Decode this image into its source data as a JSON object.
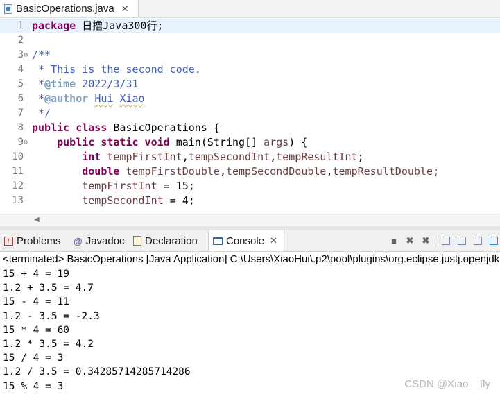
{
  "editor_tab": {
    "label": "BasicOperations.java",
    "close": "✕"
  },
  "code_lines": [
    {
      "ln": "1",
      "fold": "",
      "current": true,
      "tokens": [
        [
          "kw",
          "package"
        ],
        [
          "plain",
          " 日撸Java300行;"
        ]
      ]
    },
    {
      "ln": "2",
      "fold": "",
      "tokens": []
    },
    {
      "ln": "3",
      "fold": "⊖",
      "tokens": [
        [
          "cm",
          "/**"
        ]
      ]
    },
    {
      "ln": "4",
      "fold": "",
      "tokens": [
        [
          "cm",
          " * This is the second code."
        ]
      ]
    },
    {
      "ln": "5",
      "fold": "",
      "tokens": [
        [
          "cm",
          " *"
        ],
        [
          "tag",
          "@time"
        ],
        [
          "cm",
          " 2022/3/31"
        ]
      ]
    },
    {
      "ln": "6",
      "fold": "",
      "tokens": [
        [
          "cm",
          " *"
        ],
        [
          "tag",
          "@author"
        ],
        [
          "cm",
          " "
        ],
        [
          "cm squig",
          "Hui"
        ],
        [
          "cm",
          " "
        ],
        [
          "cm squig",
          "Xiao"
        ]
      ]
    },
    {
      "ln": "7",
      "fold": "",
      "tokens": [
        [
          "cm",
          " */"
        ]
      ]
    },
    {
      "ln": "8",
      "fold": "",
      "tokens": [
        [
          "kw",
          "public class"
        ],
        [
          "plain",
          " BasicOperations {"
        ]
      ]
    },
    {
      "ln": "9",
      "fold": "⊖",
      "tokens": [
        [
          "plain",
          "    "
        ],
        [
          "kw",
          "public static void"
        ],
        [
          "plain",
          " main(String[] "
        ],
        [
          "var",
          "args"
        ],
        [
          "plain",
          ") {"
        ]
      ]
    },
    {
      "ln": "10",
      "fold": "",
      "tokens": [
        [
          "plain",
          "        "
        ],
        [
          "kw",
          "int"
        ],
        [
          "plain",
          " "
        ],
        [
          "var",
          "tempFirstInt"
        ],
        [
          "plain",
          ","
        ],
        [
          "var",
          "tempSecondInt"
        ],
        [
          "plain",
          ","
        ],
        [
          "var",
          "tempResultInt"
        ],
        [
          "plain",
          ";"
        ]
      ]
    },
    {
      "ln": "11",
      "fold": "",
      "tokens": [
        [
          "plain",
          "        "
        ],
        [
          "kw",
          "double"
        ],
        [
          "plain",
          " "
        ],
        [
          "var",
          "tempFirstDouble"
        ],
        [
          "plain",
          ","
        ],
        [
          "var",
          "tempSecondDouble"
        ],
        [
          "plain",
          ","
        ],
        [
          "var",
          "tempResultDouble"
        ],
        [
          "plain",
          ";"
        ]
      ]
    },
    {
      "ln": "12",
      "fold": "",
      "tokens": [
        [
          "plain",
          "        "
        ],
        [
          "var",
          "tempFirstInt"
        ],
        [
          "plain",
          " = 15;"
        ]
      ]
    },
    {
      "ln": "13",
      "fold": "",
      "tokens": [
        [
          "plain",
          "        "
        ],
        [
          "var",
          "tempSecondInt"
        ],
        [
          "plain",
          " = 4;"
        ]
      ]
    }
  ],
  "view_tabs": [
    {
      "id": "problems",
      "label": "Problems",
      "icon": "problems-icon"
    },
    {
      "id": "javadoc",
      "label": "Javadoc",
      "icon": "javadoc-icon",
      "glyph": "@"
    },
    {
      "id": "declaration",
      "label": "Declaration",
      "icon": "declaration-icon"
    },
    {
      "id": "console",
      "label": "Console",
      "icon": "console-icon",
      "active": true,
      "close": "✕"
    }
  ],
  "console": {
    "header": "<terminated> BasicOperations [Java Application] C:\\Users\\XiaoHui\\.p2\\pool\\plugins\\org.eclipse.justj.openjdk",
    "output": [
      "15 + 4 = 19",
      "1.2 + 3.5 = 4.7",
      "15 - 4 = 11",
      "1.2 - 3.5 = -2.3",
      "15 * 4 = 60",
      "1.2 * 3.5 = 4.2",
      "15 / 4 = 3",
      "1.2 / 3.5 = 0.34285714285714286",
      "15 % 4 = 3"
    ]
  },
  "watermark": "CSDN @Xiao__fly",
  "colors": {
    "keyword": "#7f0055",
    "comment": "#3f5fbf",
    "variable": "#6a3e3e",
    "current_line": "#e8f2fe"
  }
}
